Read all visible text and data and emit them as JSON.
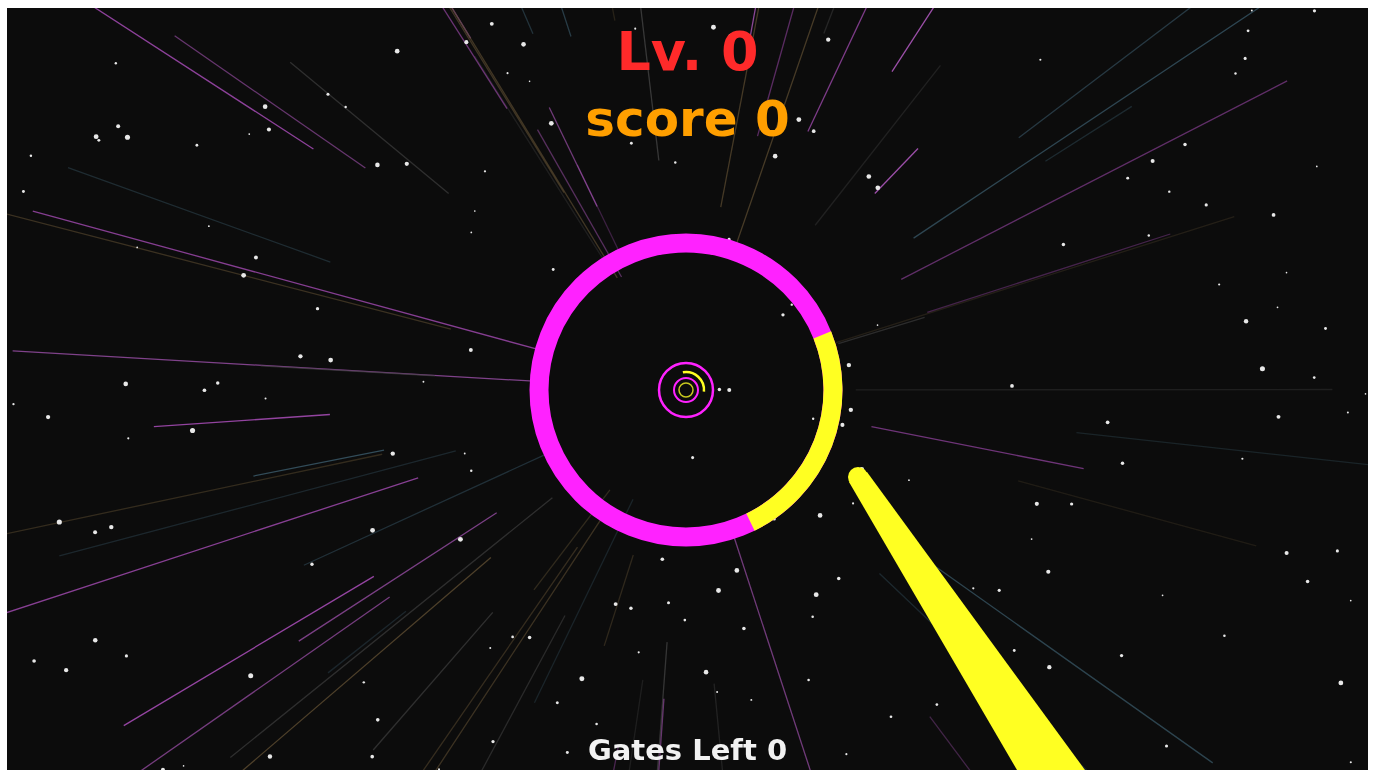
{
  "hud": {
    "level": "Lv. 0",
    "score": "score 0",
    "gates_left": "Gates Left 0"
  }
}
